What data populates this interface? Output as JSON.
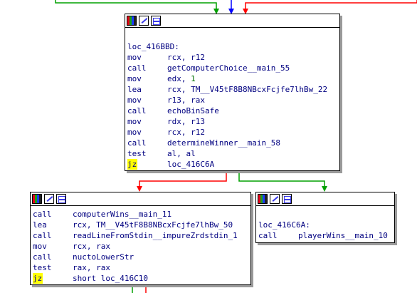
{
  "nodes": {
    "main": {
      "lines": [
        {
          "type": "blank"
        },
        {
          "type": "label",
          "text": "loc_416BBD:"
        },
        {
          "type": "ins",
          "mn": "mov",
          "op": "rcx, r12"
        },
        {
          "type": "ins",
          "mn": "call",
          "op": "getComputerChoice__main_55"
        },
        {
          "type": "ins",
          "mn": "mov",
          "op": "edx, ",
          "num": "1"
        },
        {
          "type": "ins",
          "mn": "lea",
          "op": "rcx, TM__V45tF8B8NBcxFcjfe7lhBw_22"
        },
        {
          "type": "ins",
          "mn": "mov",
          "op": "r13, rax"
        },
        {
          "type": "ins",
          "mn": "call",
          "op": "echoBinSafe"
        },
        {
          "type": "ins",
          "mn": "mov",
          "op": "rdx, r13"
        },
        {
          "type": "ins",
          "mn": "mov",
          "op": "rcx, r12"
        },
        {
          "type": "ins",
          "mn": "call",
          "op": "determineWinner__main_58"
        },
        {
          "type": "ins",
          "mn": "test",
          "op": "al, al"
        },
        {
          "type": "cond",
          "mn": "jz",
          "op": "loc_416C6A"
        }
      ]
    },
    "left": {
      "lines": [
        {
          "type": "ins",
          "mn": "call",
          "op": "computerWins__main_11"
        },
        {
          "type": "ins",
          "mn": "lea",
          "op": "rcx, TM__V45tF8B8NBcxFcjfe7lhBw_50"
        },
        {
          "type": "ins",
          "mn": "call",
          "op": "readLineFromStdin__impureZrdstdin_1"
        },
        {
          "type": "ins",
          "mn": "mov",
          "op": "rcx, rax"
        },
        {
          "type": "ins",
          "mn": "call",
          "op": "nuctoLowerStr"
        },
        {
          "type": "ins",
          "mn": "test",
          "op": "rax, rax"
        },
        {
          "type": "cond",
          "mn": "jz",
          "op": "short loc_416C10"
        }
      ]
    },
    "right": {
      "lines": [
        {
          "type": "blank"
        },
        {
          "type": "label",
          "text": "loc_416C6A:"
        },
        {
          "type": "ins",
          "mn": "call",
          "op": "playerWins__main_10"
        }
      ]
    }
  },
  "header_icons": [
    "palette-icon",
    "edit-icon",
    "graph-icon"
  ],
  "colors": {
    "edge_green": "#00a000",
    "edge_blue": "#0000ff",
    "edge_red": "#ff0000",
    "asm_text": "#000080",
    "highlight": "#ffff00"
  }
}
